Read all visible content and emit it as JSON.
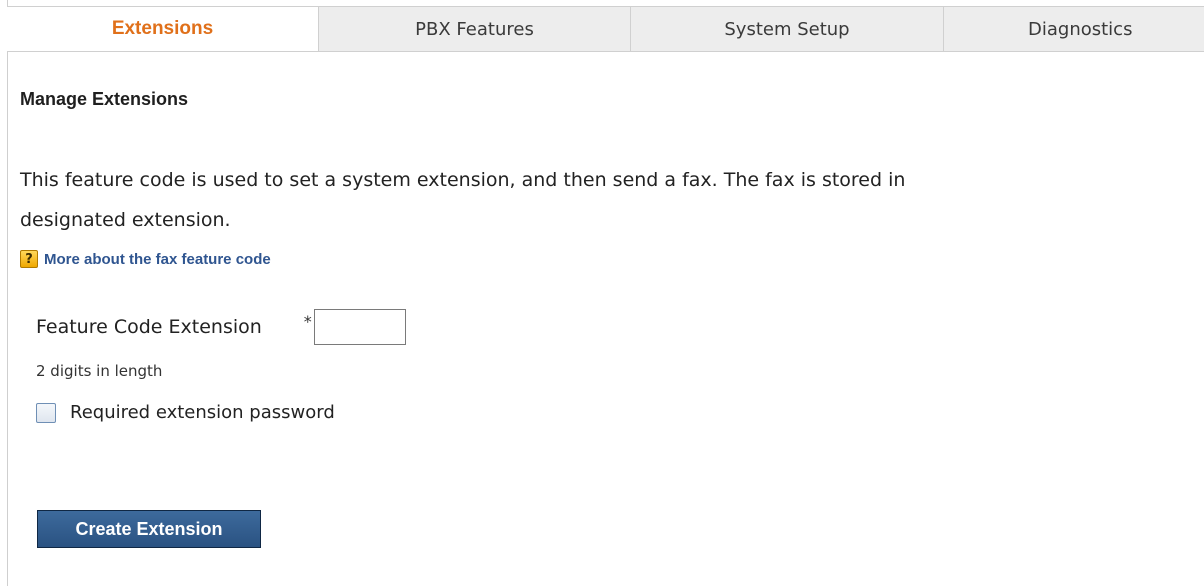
{
  "tabs": [
    {
      "label": "Extensions",
      "active": true
    },
    {
      "label": "PBX Features",
      "active": false
    },
    {
      "label": "System Setup",
      "active": false
    },
    {
      "label": "Diagnostics",
      "active": false
    }
  ],
  "page": {
    "title": "Manage Extensions",
    "description_line1": "This feature code is used to set a system extension, and then send a fax. The fax is stored in",
    "description_line2": "designated extension.",
    "help_icon_glyph": "?",
    "help_link": "More about the fax feature code"
  },
  "form": {
    "feature_code_label": "Feature Code Extension",
    "required_mark": "*",
    "feature_code_value": "",
    "hint": "2 digits in length",
    "password_checkbox_label": "Required extension password",
    "password_checkbox_checked": false,
    "submit_label": "Create Extension"
  },
  "colors": {
    "active_tab_text": "#e0701a",
    "link": "#2f5590",
    "button_bg": "#2a5282"
  }
}
